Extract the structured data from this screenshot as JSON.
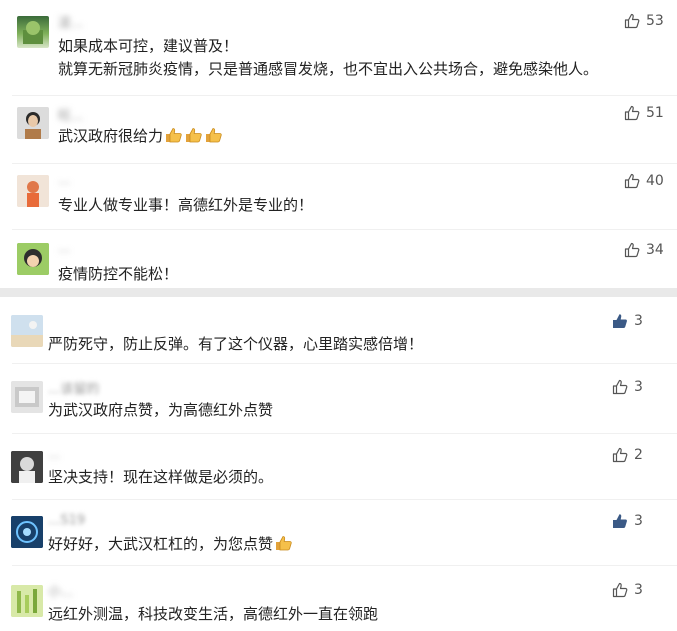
{
  "top_panel": {
    "comments": [
      {
        "name": "凌...",
        "lines": [
          "如果成本可控，建议普及！",
          "就算无新冠肺炎疫情，只是普通感冒发烧，也不宜出入公共场合，避免感染他人。"
        ],
        "likes": "53"
      },
      {
        "name": "旺...",
        "lines": [
          "武汉政府很给力"
        ],
        "likes": "51",
        "emoji_thumbs": 3
      },
      {
        "name": "...",
        "lines": [
          "专业人做专业事！高德红外是专业的！"
        ],
        "likes": "40"
      },
      {
        "name": "...",
        "lines": [
          "疫情防控不能松！"
        ],
        "likes": "34"
      }
    ]
  },
  "bottom_panel": {
    "comments": [
      {
        "name": "",
        "text": "严防死守，防止反弹。有了这个仪器，心里踏实感倍增！",
        "likes": "3",
        "liked": true
      },
      {
        "name": "...该留的",
        "text": "为武汉政府点赞，为高德红外点赞",
        "likes": "3",
        "liked": false
      },
      {
        "name": "...",
        "text": "坚决支持！现在这样做是必须的。",
        "likes": "2",
        "liked": false
      },
      {
        "name": "...S19",
        "text": "好好好，大武汉杠杠的，为您点赞",
        "likes": "3",
        "liked": true,
        "emoji_thumbs": 1
      },
      {
        "name": "小...",
        "text": "远红外测温，科技改变生活，高德红外一直在领跑",
        "likes": "3",
        "liked": false
      }
    ]
  },
  "icons": {
    "like": "thumbs-up-icon",
    "emoji": "thumbs-up-emoji-icon"
  },
  "colors": {
    "text": "#222222",
    "meta": "#8a8a8a",
    "liked": "#3b5a86",
    "separator": "#e9e9e9"
  }
}
